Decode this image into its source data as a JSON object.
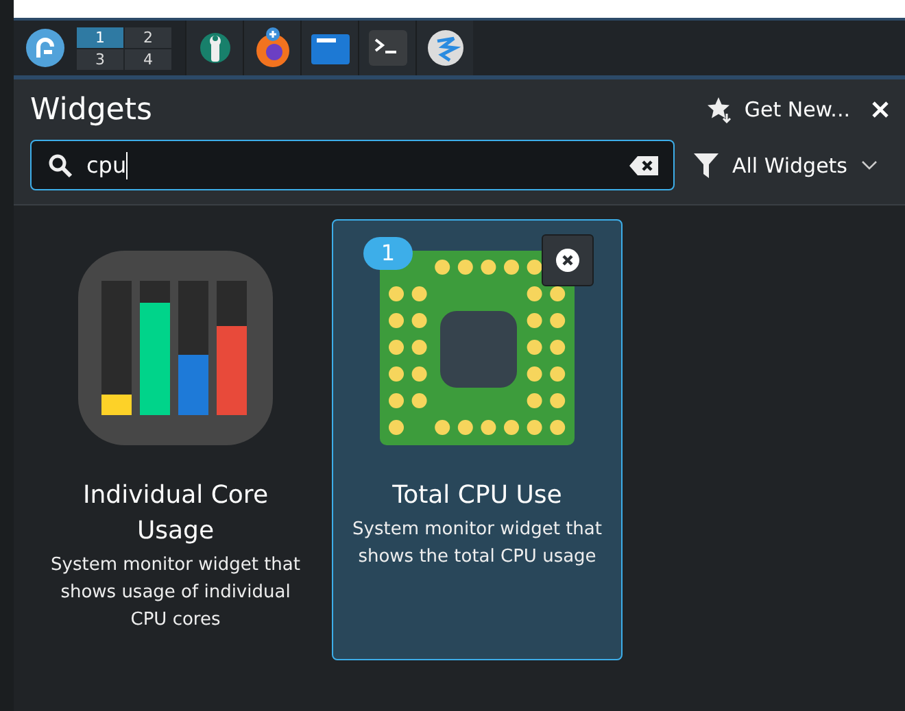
{
  "taskbar": {
    "pager": [
      {
        "label": "1",
        "selected": true
      },
      {
        "label": "2",
        "selected": false
      },
      {
        "label": "3",
        "selected": false
      },
      {
        "label": "4",
        "selected": false
      }
    ],
    "tasks": [
      {
        "kind": "settings"
      },
      {
        "kind": "browser"
      },
      {
        "kind": "folder"
      },
      {
        "kind": "terminal"
      },
      {
        "kind": "app"
      }
    ]
  },
  "panel": {
    "title": "Widgets",
    "get_new": "Get New...",
    "search": {
      "value": "cpu"
    },
    "filter": "All Widgets"
  },
  "widgets": [
    {
      "kind": "cores",
      "name": "Individual Core Usage",
      "description": "System monitor widget that shows usage of individual CPU cores",
      "selected": false
    },
    {
      "kind": "cpu",
      "name": "Total CPU Use",
      "description": "System monitor widget that shows the total CPU usage",
      "selected": true,
      "instances": "1"
    }
  ]
}
